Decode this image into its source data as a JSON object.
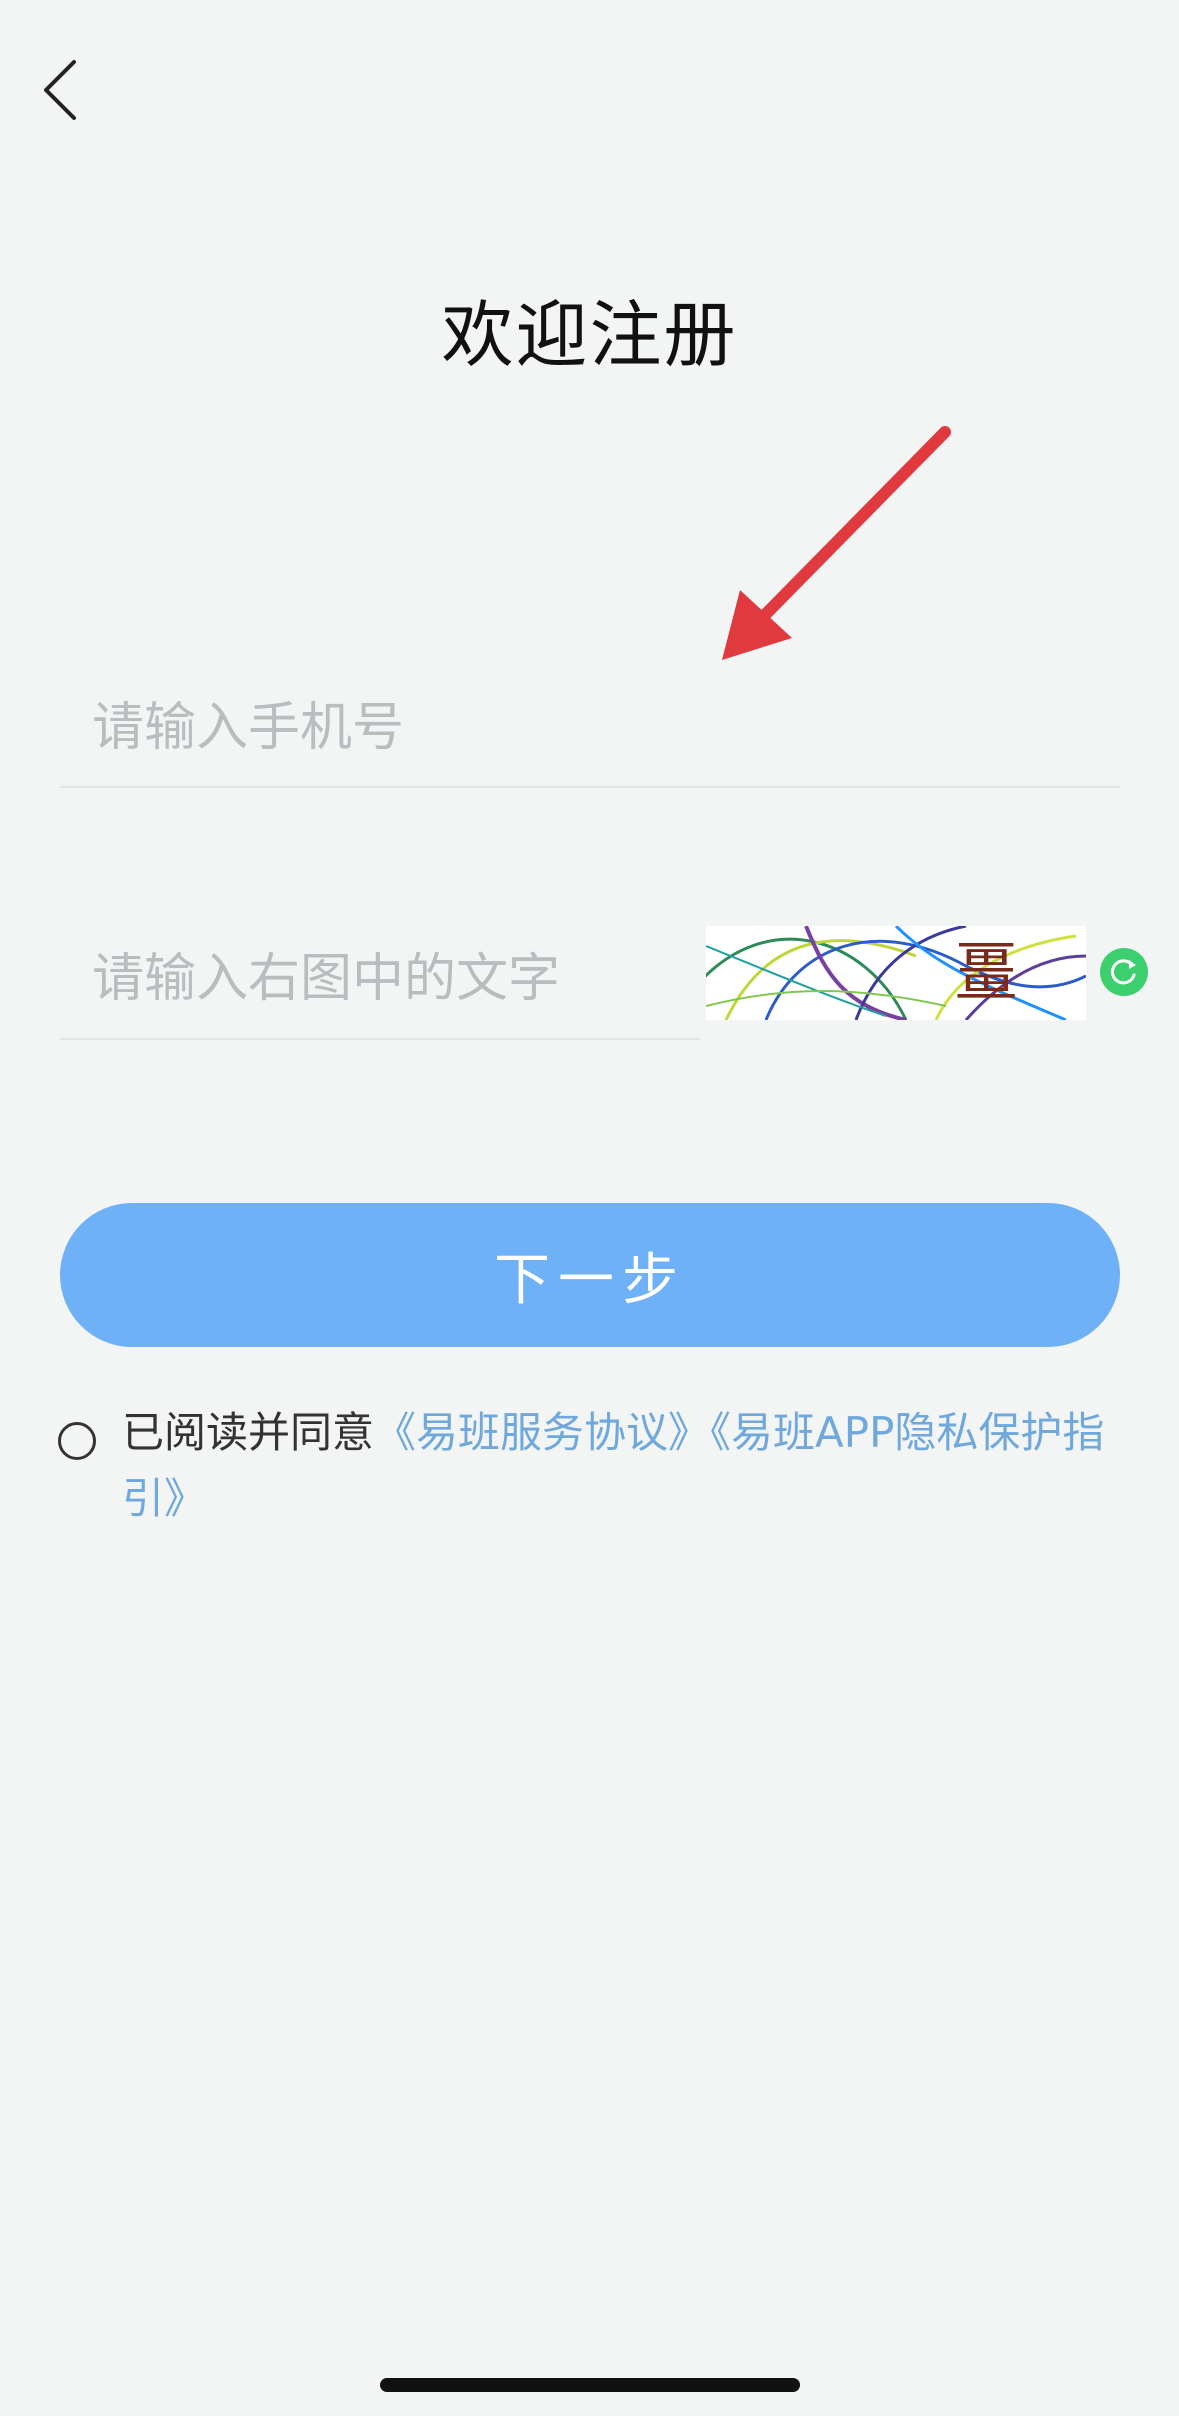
{
  "header": {
    "back_icon": "chevron-left-icon",
    "title": "欢迎注册"
  },
  "form": {
    "phone_placeholder": "请输入手机号",
    "captcha_placeholder": "请输入右图中的文字",
    "captcha_char": "畺",
    "refresh_icon": "refresh-icon"
  },
  "actions": {
    "next_label": "下一步"
  },
  "agreement": {
    "prefix": "已阅读并同意",
    "service_link": "《易班服务协议》",
    "privacy_link": "《易班APP隐私保护指引》"
  },
  "colors": {
    "background": "#f3f5f5",
    "button": "#6eb1f7",
    "link": "#6fa8dc",
    "annotation_arrow": "#e0393e",
    "refresh": "#3ccf6e"
  }
}
